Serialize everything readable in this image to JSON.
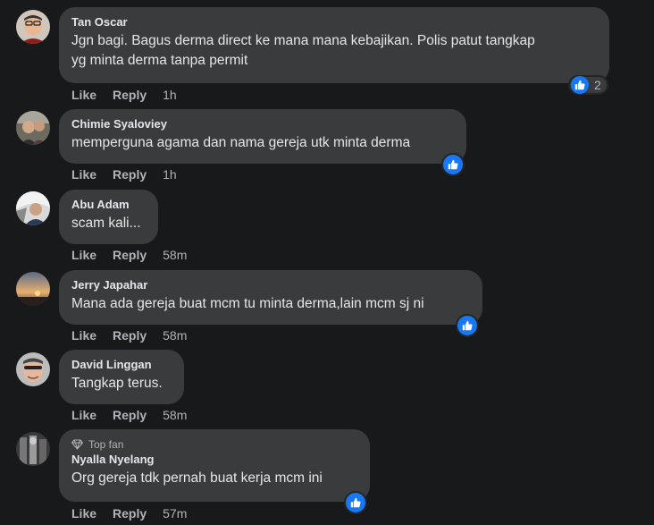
{
  "actions": {
    "like": "Like",
    "reply": "Reply"
  },
  "comments": [
    {
      "author": "Tan Oscar",
      "text_line1": "Jgn bagi. Bagus derma direct ke mana mana kebajikan. Polis patut tangkap",
      "text_line2": "yg minta derma tanpa permit",
      "time": "1h",
      "reaction_count": "2"
    },
    {
      "author": "Chimie Syaloviey",
      "text": "memperguna agama dan nama gereja utk minta derma",
      "time": "1h"
    },
    {
      "author": "Abu Adam",
      "text": "scam kali...",
      "time": "58m"
    },
    {
      "author": "Jerry Japahar",
      "text": "Mana ada gereja buat mcm tu minta derma,lain mcm sj ni",
      "time": "58m"
    },
    {
      "author": "David Linggan",
      "text": "Tangkap terus.",
      "time": "58m"
    },
    {
      "badge": "Top fan",
      "author": "Nyalla Nyelang",
      "text": "Org gereja tdk pernah buat kerja mcm ini",
      "time": "57m"
    }
  ],
  "icons": {
    "like_reaction": "thumbs-up-icon",
    "top_fan": "diamond-icon"
  },
  "colors": {
    "background": "#18191a",
    "bubble": "#3a3b3c",
    "like_blue": "#1877f2",
    "text": "#e4e6eb",
    "muted": "#b0b3b8"
  }
}
